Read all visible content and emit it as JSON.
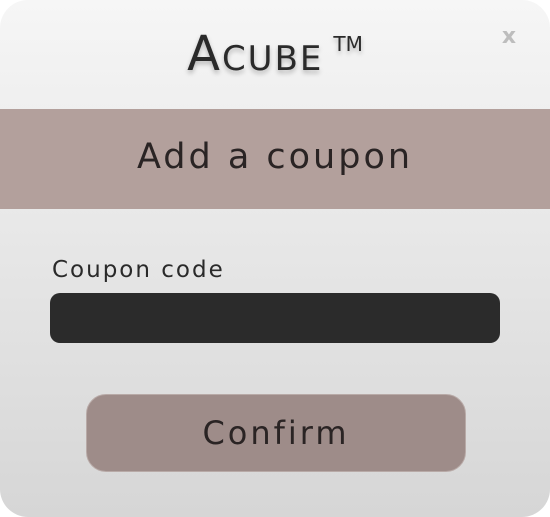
{
  "header": {
    "brand_name": "Acube",
    "trademark": "TM",
    "close_label": "x"
  },
  "banner": {
    "title": "Add a coupon"
  },
  "form": {
    "coupon_label": "Coupon code",
    "coupon_value": "",
    "confirm_label": "Confirm"
  },
  "colors": {
    "banner": "#b3a09c",
    "input_bg": "#2b2b2b",
    "button_bg": "#9e8c89"
  }
}
